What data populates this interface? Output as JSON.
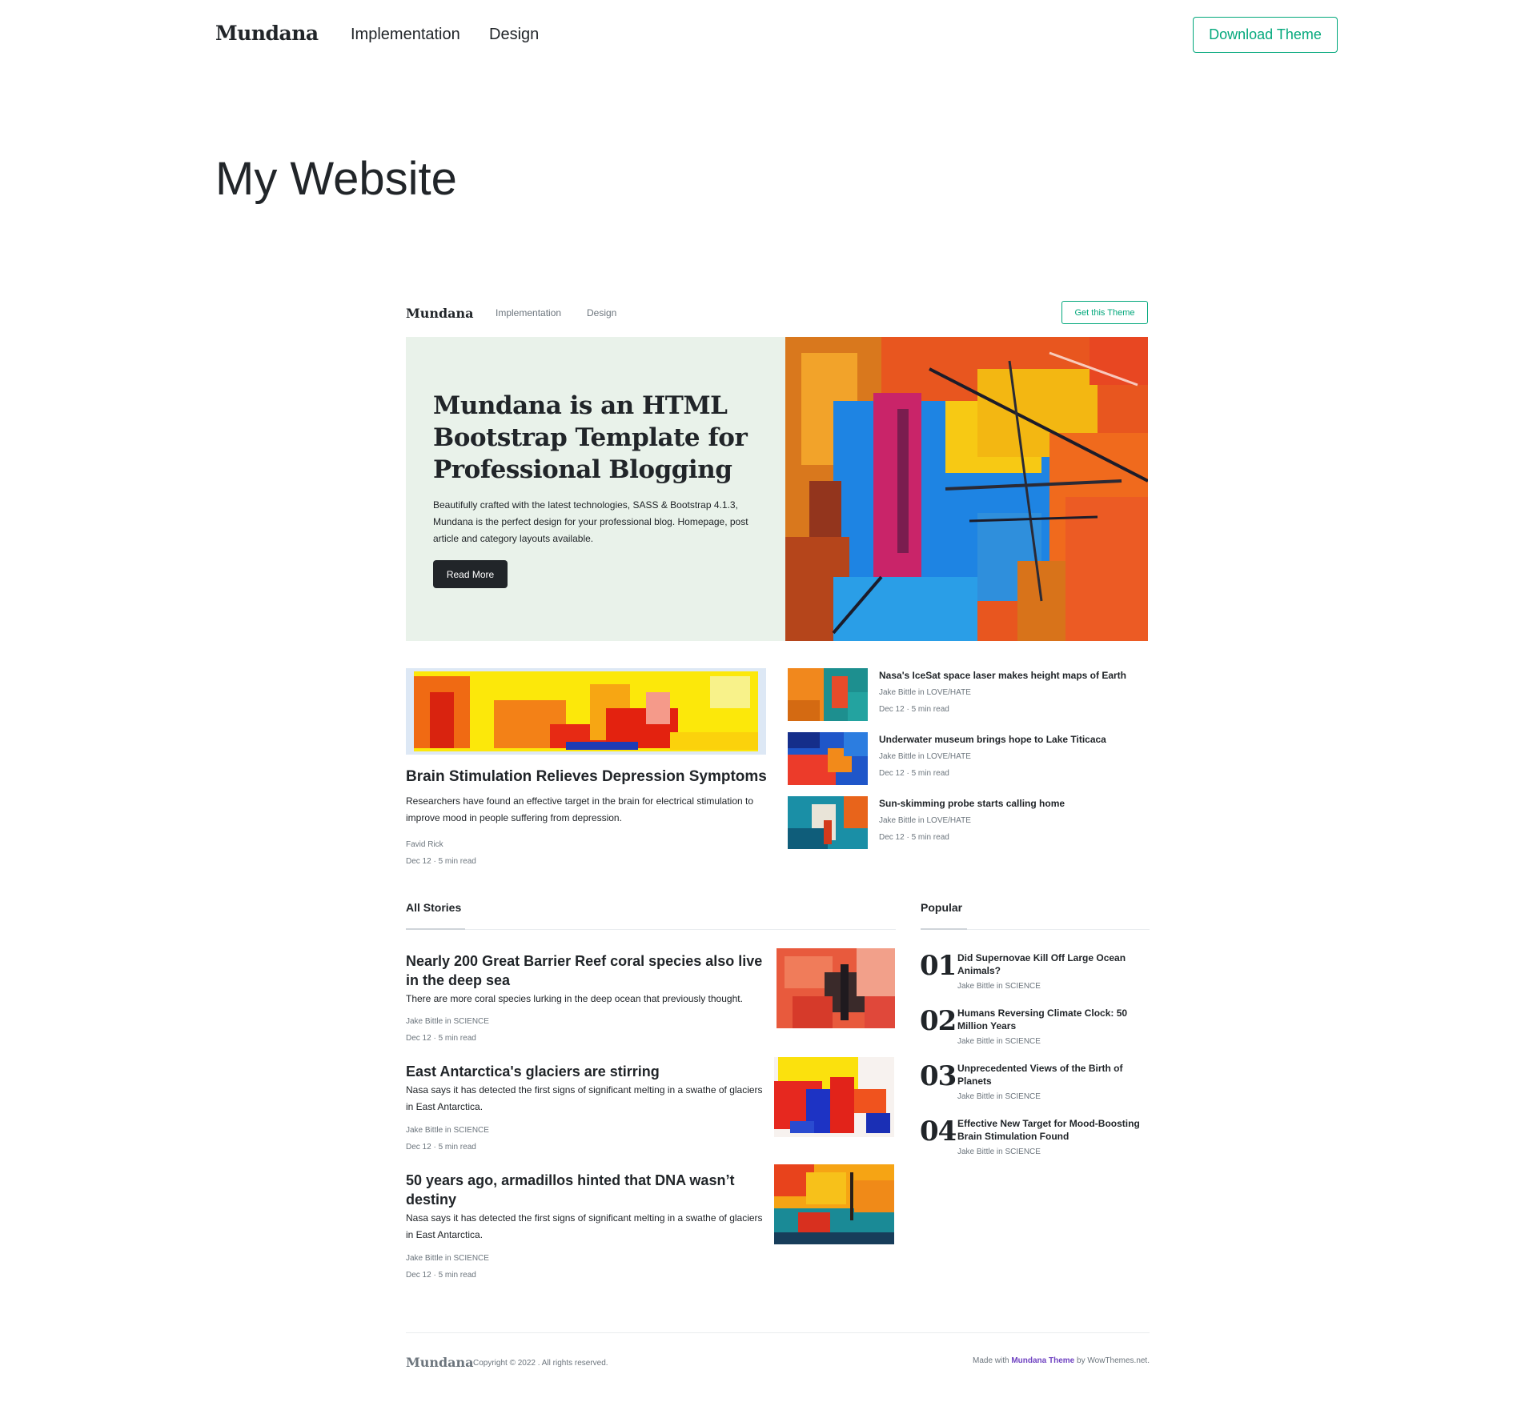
{
  "outer_nav": {
    "logo": "Mundana",
    "links": [
      "Implementation",
      "Design"
    ],
    "download_label": "Download Theme"
  },
  "page_title": "My Website",
  "inner_nav": {
    "logo": "Mundana",
    "links": [
      "Implementation",
      "Design"
    ],
    "cta_label": "Get this Theme"
  },
  "hero": {
    "title": "Mundana is an HTML Bootstrap Template for Professional Blogging",
    "description": "Beautifully crafted with the latest technologies, SASS & Bootstrap 4.1.3, Mundana is the perfect design for your professional blog. Homepage, post article and category layouts available.",
    "button_label": "Read More"
  },
  "featured": {
    "title": "Brain Stimulation Relieves Depression Symptoms",
    "description": "Researchers have found an effective target in the brain for electrical stimulation to improve mood in people suffering from depression.",
    "author": "Favid Rick",
    "meta": "Dec 12 · 5 min read"
  },
  "side_posts": [
    {
      "title": "Nasa's IceSat space laser makes height maps of Earth",
      "author": "Jake Bittle in LOVE/HATE",
      "meta": "Dec 12 · 5 min read"
    },
    {
      "title": "Underwater museum brings hope to Lake Titicaca",
      "author": "Jake Bittle in LOVE/HATE",
      "meta": "Dec 12 · 5 min read"
    },
    {
      "title": "Sun-skimming probe starts calling home",
      "author": "Jake Bittle in LOVE/HATE",
      "meta": "Dec 12 · 5 min read"
    }
  ],
  "all_stories": {
    "label": "All Stories",
    "items": [
      {
        "title": "Nearly 200 Great Barrier Reef coral species also live in the deep sea",
        "description": "There are more coral species lurking in the deep ocean that previously thought.",
        "author": "Jake Bittle in SCIENCE",
        "meta": "Dec 12 · 5 min read"
      },
      {
        "title": "East Antarctica's glaciers are stirring",
        "description": "Nasa says it has detected the first signs of significant melting in a swathe of glaciers in East Antarctica.",
        "author": "Jake Bittle in SCIENCE",
        "meta": "Dec 12 · 5 min read"
      },
      {
        "title": "50 years ago, armadillos hinted that DNA wasn’t destiny",
        "description": "Nasa says it has detected the first signs of significant melting in a swathe of glaciers in East Antarctica.",
        "author": "Jake Bittle in SCIENCE",
        "meta": "Dec 12 · 5 min read"
      }
    ]
  },
  "popular": {
    "label": "Popular",
    "items": [
      {
        "num": "01",
        "title": "Did Supernovae Kill Off Large Ocean Animals?",
        "author": "Jake Bittle in SCIENCE"
      },
      {
        "num": "02",
        "title": "Humans Reversing Climate Clock: 50 Million Years",
        "author": "Jake Bittle in SCIENCE"
      },
      {
        "num": "03",
        "title": "Unprecedented Views of the Birth of Planets",
        "author": "Jake Bittle in SCIENCE"
      },
      {
        "num": "04",
        "title": "Effective New Target for Mood-Boosting Brain Stimulation Found",
        "author": "Jake Bittle in SCIENCE"
      }
    ]
  },
  "footer": {
    "logo": "Mundana",
    "copyright": "Copyright © 2022 . All rights reserved.",
    "made_prefix": "Made with",
    "theme_link": "Mundana Theme",
    "made_suffix": "by WowThemes.net."
  },
  "colors": {
    "accent": "#03a87c",
    "hero_bg": "#e9f2ea",
    "dark": "#212529",
    "muted": "#6c757d",
    "link": "#6f42c1"
  }
}
